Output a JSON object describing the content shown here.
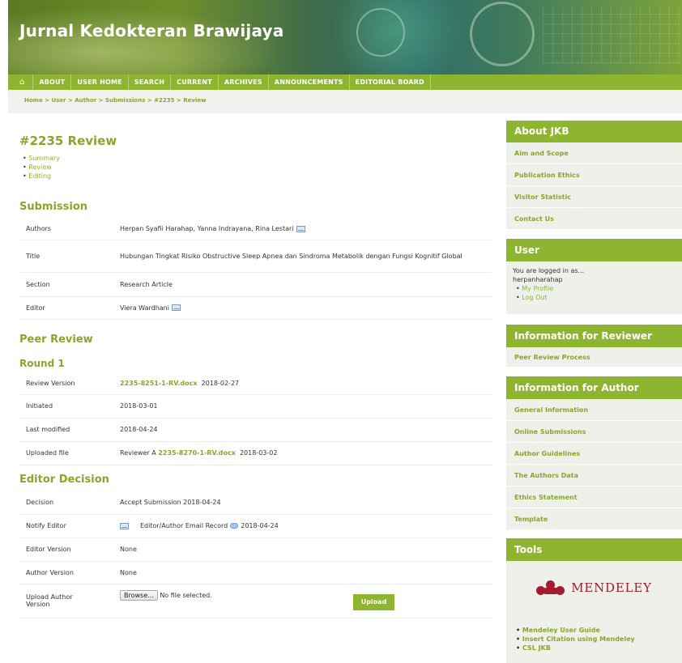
{
  "site": {
    "title": "Jurnal Kedokteran Brawijaya"
  },
  "nav": {
    "items": [
      "ABOUT",
      "USER HOME",
      "SEARCH",
      "CURRENT",
      "ARCHIVES",
      "ANNOUNCEMENTS",
      "EDITORIAL BOARD"
    ]
  },
  "breadcrumb": {
    "text": "Home > User > Author > Submissions > #2235 > Review"
  },
  "main": {
    "page_title": "#2235 Review",
    "sublinks": [
      "Summary",
      "Review",
      "Editing"
    ],
    "submission": {
      "heading": "Submission",
      "rows": [
        {
          "label": "Authors",
          "value": "Herpan Syafii Harahap, Yanna Indrayana, Rina Lestari"
        },
        {
          "label": "Title",
          "value": "Hubungan Tingkat Risiko Obstructive Sleep Apnea dan Sindroma Metabolik dengan Fungsi Kognitif Global"
        },
        {
          "label": "Section",
          "value": "Research Article"
        },
        {
          "label": "Editor",
          "value": "Viera Wardhani"
        }
      ]
    },
    "peer_review": {
      "heading": "Peer Review",
      "round": "Round 1",
      "review_version": {
        "label": "Review Version",
        "file": "2235-8251-1-RV.docx",
        "date": "2018-02-27"
      },
      "initiated": {
        "label": "Initiated",
        "value": "2018-03-01"
      },
      "last_modified": {
        "label": "Last modified",
        "value": "2018-04-24"
      },
      "uploaded_file": {
        "label": "Uploaded file",
        "prefix": "Reviewer A",
        "file": "2235-8270-1-RV.docx",
        "date": "2018-03-02"
      }
    },
    "editor_decision": {
      "heading": "Editor Decision",
      "decision": {
        "label": "Decision",
        "value": "Accept Submission 2018-04-24"
      },
      "notify": {
        "label": "Notify Editor",
        "record": "Editor/Author Email Record",
        "date": "2018-04-24"
      },
      "editor_version": {
        "label": "Editor Version",
        "value": "None"
      },
      "author_version": {
        "label": "Author Version",
        "value": "None"
      },
      "upload": {
        "label": "Upload Author Version",
        "browse": "Browse...",
        "status": "No file selected.",
        "button": "Upload"
      }
    }
  },
  "sidebar": {
    "about": {
      "title": "About JKB",
      "items": [
        "Aim and Scope",
        "Publication Ethics",
        "Visitor Statistic",
        "Contact Us"
      ]
    },
    "user": {
      "title": "User",
      "logged_in": "You are logged in as...",
      "username": "herpanharahap",
      "links": [
        "My Profile",
        "Log Out"
      ]
    },
    "reviewer": {
      "title": "Information for Reviewer",
      "items": [
        "Peer Review Process"
      ]
    },
    "author": {
      "title": "Information for Author",
      "items": [
        "General Information",
        "Online Submissions",
        "Author Guidelines",
        "The Authors Data",
        "Ethics Statement",
        "Template"
      ]
    },
    "tools": {
      "title": "Tools",
      "logo_text": "MENDELEY",
      "links": [
        "Mendeley User Guide",
        "Insert Citation using Mendeley",
        "CSL JKB"
      ]
    }
  },
  "colors": {
    "accent": "#8db530",
    "link": "#8aa52e",
    "panel": "#eef0ea"
  },
  "icons": {
    "home": "home-icon",
    "envelope": "envelope-icon",
    "comment": "comment-icon"
  }
}
